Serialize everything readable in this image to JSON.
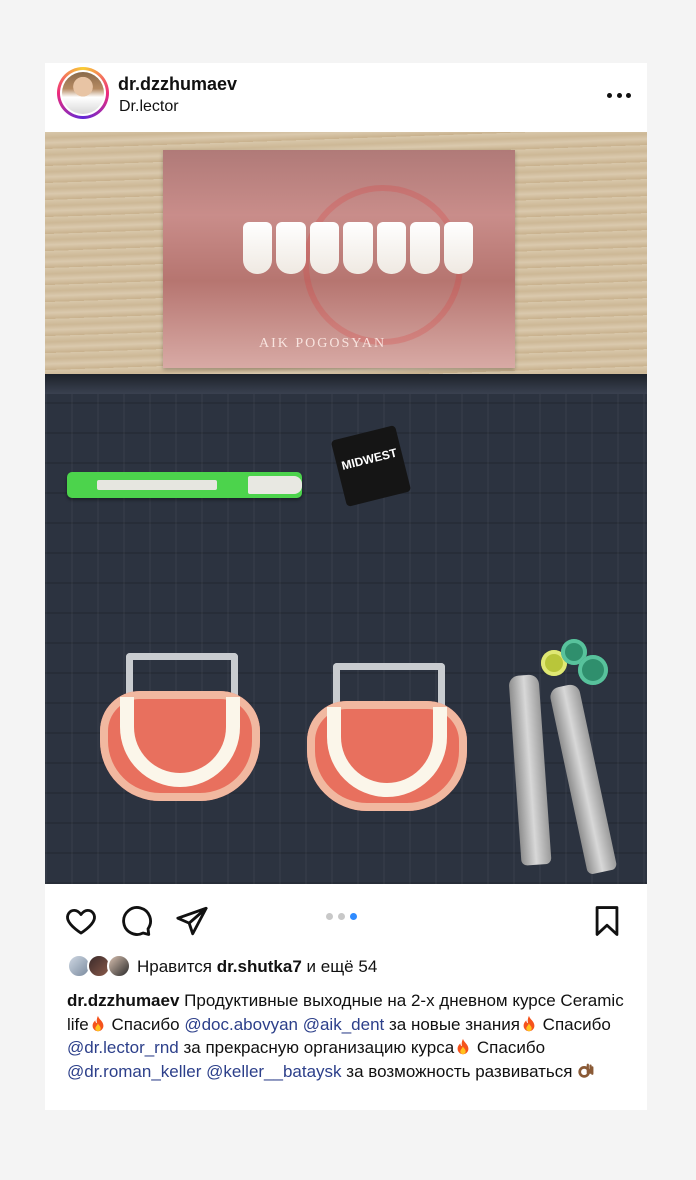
{
  "post": {
    "username": "dr.dzzhumaev",
    "subtitle": "Dr.lector",
    "photo_print_text": "AIK POGOSYAN",
    "box_label": "MIDWEST",
    "carousel": {
      "count": 3,
      "active_index": 3
    }
  },
  "likes": {
    "prefix": "Нравится ",
    "user": "dr.shutka7",
    "suffix": " и ещё 54"
  },
  "caption": {
    "author": "dr.dzzhumaev",
    "t1": " Продуктивные выходные на 2-х дневном курсе Ceramic life",
    "t2": "  Спасибо ",
    "m1": "@doc.abovyan",
    "t3": " ",
    "m2": "@aik_dent",
    "t4": "  за новые знания",
    "t5": "  Спасибо ",
    "m3": "@dr.lector_rnd",
    "t6": " за прекрасную организацию курса",
    "t7": "  Спасибо ",
    "m4": "@dr.roman_keller",
    "t8": " ",
    "m5": "@keller__bataysk",
    "t9": " за возможность развиваться"
  },
  "icons": {
    "more": "more-options-icon",
    "like": "heart-icon",
    "comment": "comment-icon",
    "share": "share-icon",
    "save": "bookmark-icon",
    "emoji_fire": "fire-emoji",
    "emoji_ok": "ok-hand-emoji"
  },
  "colors": {
    "mention": "#2c3f8a",
    "carousel_active": "#2f8bff",
    "carousel_inactive": "#c8c8c8"
  }
}
